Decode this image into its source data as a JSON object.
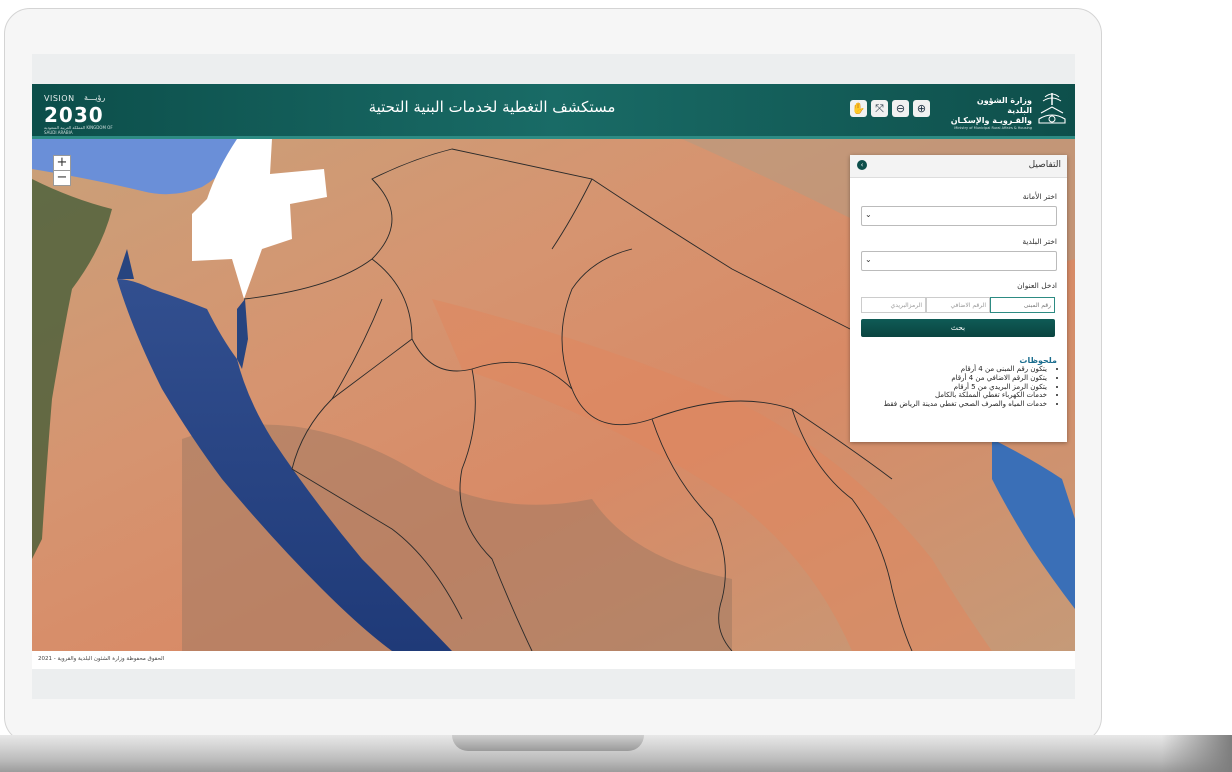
{
  "header": {
    "title": "مستكشف التغطية لخدمات البنية التحتية",
    "vision_label": "VISION",
    "vision_arabic": "رؤيـــة",
    "vision_number": "2030",
    "vision_sub": "المملكة العربية السعودية KINGDOM OF SAUDI ARABIA",
    "ministry_line1": "وزارة الشؤون البلدية",
    "ministry_line2": "والقـرويـة والإسكـان",
    "ministry_sub": "Ministry of Municipal Rural Affairs & Housing",
    "tools": [
      {
        "name": "pan-hand-icon",
        "glyph": "✋"
      },
      {
        "name": "full-extent-icon",
        "glyph": "⤧"
      },
      {
        "name": "zoom-out-icon",
        "glyph": "⊖"
      },
      {
        "name": "zoom-in-icon",
        "glyph": "⊕"
      }
    ]
  },
  "map": {
    "zoom_in": "+",
    "zoom_out": "−"
  },
  "panel": {
    "title": "التفاصيل",
    "collapse_glyph": "›",
    "amanah_label": "اختر الأمانة",
    "amanah_value": "",
    "municipality_label": "اختر البلدية",
    "municipality_value": "",
    "address_label": "ادخل العنوان",
    "building_placeholder": "رقم المبنى",
    "additional_placeholder": "الرقم الاضافي",
    "postal_placeholder": "الرمزالبريدي",
    "search_label": "بحث",
    "notes_title": "ملحوظات",
    "notes": [
      "يتكون رقم المبنى من 4 أرقام",
      "يتكون الرقم الاضافي من 4 أرقام",
      "يتكون الرمز البريدي من 5 أرقام",
      "خدمات الكهرباء تغطي المملكة بالكامل",
      "خدمات المياه والصرف الصحي تغطي مدينة الرياض فقط"
    ]
  },
  "footer": {
    "copyright": "الحقوق محفوظة وزارة الشئون البلدية والقروية - 2021"
  },
  "colors": {
    "header": "#196b66",
    "accent": "#0d4e4a",
    "sea": "#2b4a8c",
    "desert": "#d99a72"
  }
}
